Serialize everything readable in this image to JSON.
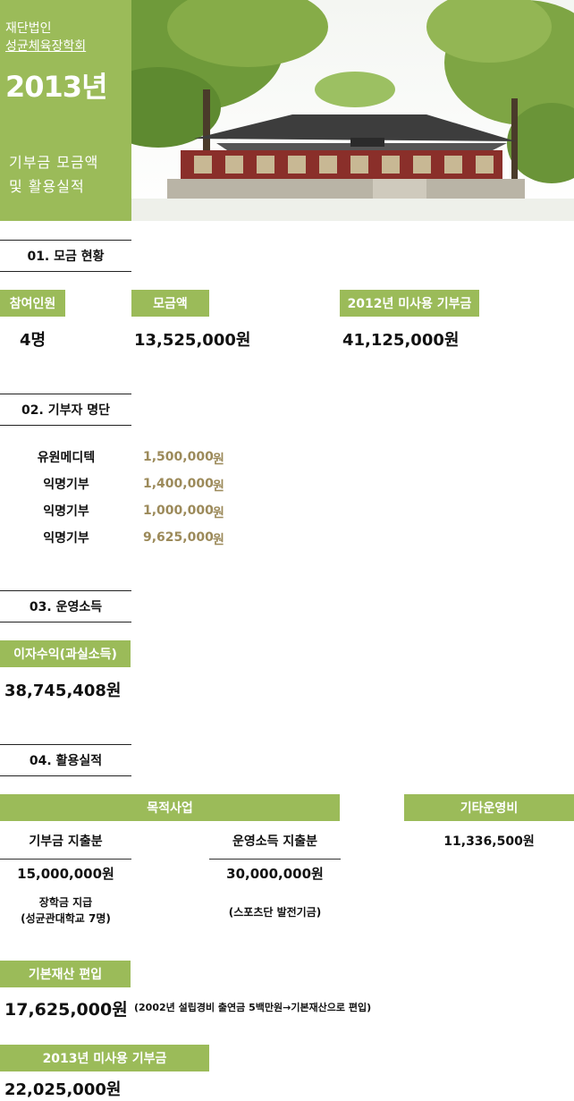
{
  "header": {
    "org_line1": "재단법인",
    "org_line2": "성균체육장학회",
    "year": "2013년",
    "subtitle_line1": "기부금 모금액",
    "subtitle_line2": "및 활용실적"
  },
  "section1": {
    "title": "01. 모금 현황",
    "participants_label": "참여인원",
    "participants_value": "4명",
    "amount_label": "모금액",
    "amount_value": "13,525,000원",
    "unused_label": "2012년 미사용 기부금",
    "unused_value": "41,125,000원"
  },
  "section2": {
    "title": "02. 기부자 명단",
    "donors": [
      {
        "name": "유원메디텍",
        "amount": "1,500,000",
        "unit": "원"
      },
      {
        "name": "익명기부",
        "amount": "1,400,000",
        "unit": "원"
      },
      {
        "name": "익명기부",
        "amount": "1,000,000",
        "unit": "원"
      },
      {
        "name": "익명기부",
        "amount": "9,625,000",
        "unit": "원"
      }
    ]
  },
  "section3": {
    "title": "03. 운영소득",
    "interest_label": "이자수익(과실소득)",
    "interest_value": "38,745,408원"
  },
  "section4": {
    "title": "04. 활용실적",
    "purpose_label": "목적사업",
    "other_label": "기타운영비",
    "other_value": "11,336,500원",
    "donation_spend_label": "기부금 지출분",
    "donation_spend_value": "15,000,000원",
    "donation_spend_note1": "장학금 지급",
    "donation_spend_note2": "(성균관대학교 7명)",
    "income_spend_label": "운영소득 지출분",
    "income_spend_value": "30,000,000원",
    "income_spend_note": "(스포츠단 발전기금)",
    "base_asset_label": "기본재산 편입",
    "base_asset_value": "17,625,000원",
    "base_asset_note": "(2002년 설립경비 출연금 5백만원→기본재산으로 편입)",
    "unused_2013_label": "2013년 미사용 기부금",
    "unused_2013_value": "22,025,000원"
  },
  "colors": {
    "accent": "#9bbb59",
    "amount_gold": "#9c8a5a"
  }
}
